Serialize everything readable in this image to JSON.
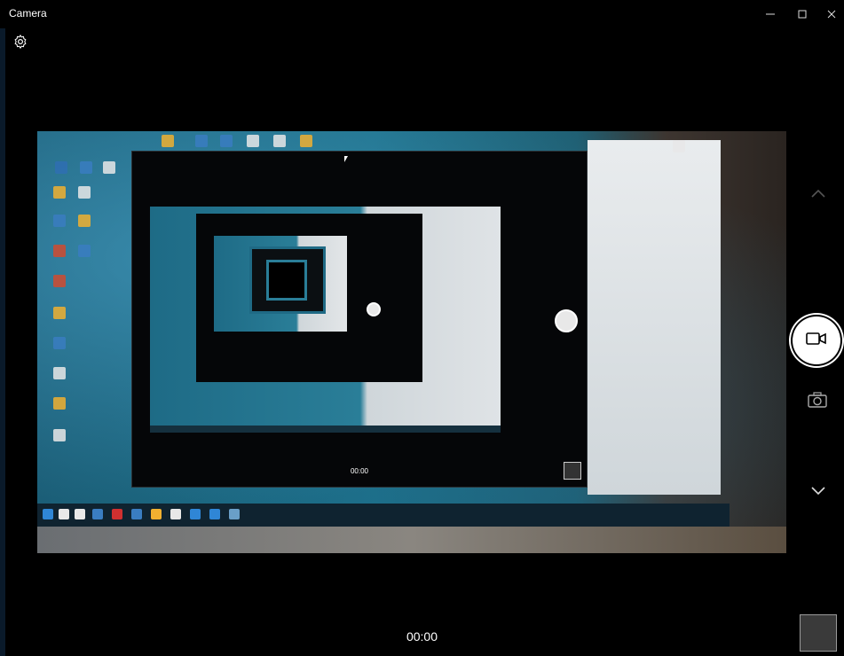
{
  "window": {
    "title": "Camera",
    "controls": {
      "minimize_icon": "minimize-icon",
      "maximize_icon": "maximize-icon",
      "close_icon": "close-icon"
    }
  },
  "toolbar": {
    "settings_icon": "gear-icon"
  },
  "preview": {
    "description_icon": "camera-preview",
    "inner_timer": "00:00"
  },
  "controls": {
    "scroll_up_icon": "chevron-up-icon",
    "record_icon": "video-camera-icon",
    "photo_mode_icon": "camera-icon",
    "scroll_down_icon": "chevron-down-icon",
    "gallery_thumbnail_icon": "thumbnail"
  },
  "status": {
    "timer": "00:00"
  },
  "colors": {
    "background": "#000000",
    "shutter": "#ffffff",
    "accent": "#1b6d86"
  }
}
